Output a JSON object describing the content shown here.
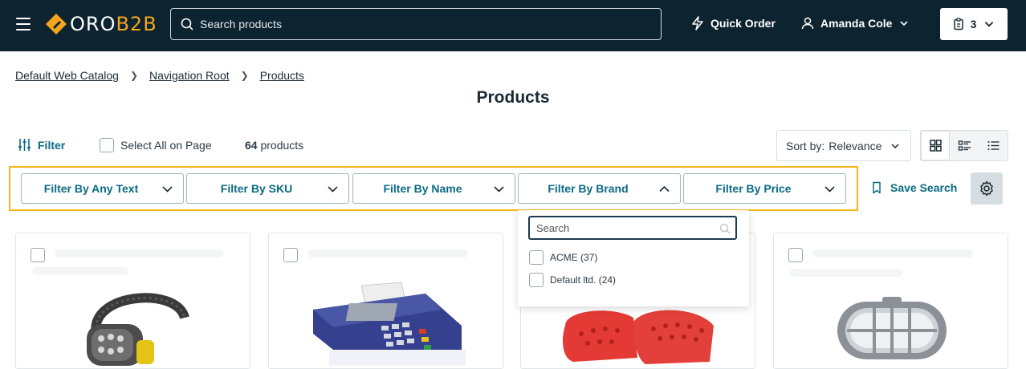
{
  "header": {
    "logo_part1": "ORO",
    "logo_part2": "B2B",
    "search_placeholder": "Search products",
    "quick_order": "Quick Order",
    "user_name": "Amanda Cole",
    "cart_count": "3"
  },
  "breadcrumb": [
    "Default Web Catalog",
    "Navigation Root",
    "Products"
  ],
  "page_title": "Products",
  "toolbar": {
    "filter_label": "Filter",
    "select_all": "Select All on Page",
    "count_number": "64",
    "count_suffix": "products",
    "sort_label": "Sort by:",
    "sort_value": "Relevance"
  },
  "filters": [
    {
      "label": "Filter By Any Text",
      "open": false
    },
    {
      "label": "Filter By SKU",
      "open": false
    },
    {
      "label": "Filter By Name",
      "open": false
    },
    {
      "label": "Filter By Brand",
      "open": true
    },
    {
      "label": "Filter By Price",
      "open": false
    }
  ],
  "save_search": "Save Search",
  "brand_dropdown": {
    "search_placeholder": "Search",
    "options": [
      "ACME (37)",
      "Default ltd. (24)"
    ]
  },
  "products": [
    {
      "image": "headlamp"
    },
    {
      "image": "card-terminal"
    },
    {
      "image": "red-clogs"
    },
    {
      "image": "bulkhead-lamp"
    }
  ],
  "colors": {
    "header_bg": "#0d2330",
    "accent_teal": "#0b6a84",
    "logo_orange": "#f4a51c",
    "highlight_border": "#f4b61b"
  }
}
